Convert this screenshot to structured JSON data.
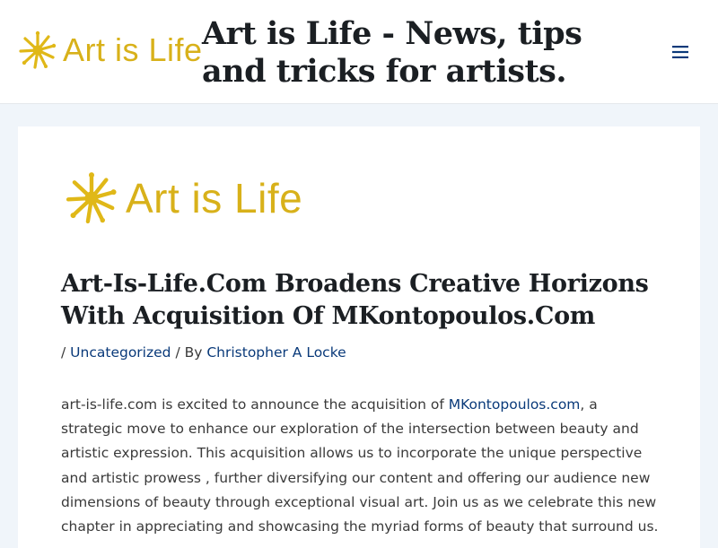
{
  "header": {
    "logo_text": "Art is Life",
    "site_title": "Art is Life - News, tips and tricks for artists.",
    "menu_icon": "hamburger-menu-icon"
  },
  "article": {
    "logo_text": "Art is Life",
    "title": "Art-Is-Life.Com Broadens Creative Horizons With Acquisition Of MKontopoulos.Com",
    "meta": {
      "prefix": "/",
      "category": "Uncategorized",
      "by_label": "/ By",
      "author": "Christopher A Locke"
    },
    "body": {
      "before_link": "art-is-life.com is excited to announce the acquisition of ",
      "link_text": "MKontopoulos.com",
      "after_link": ", a strategic move to enhance our exploration of the intersection between beauty and artistic expression. This acquisition allows us to incorporate the unique perspective and artistic prowess , further diversifying our content and offering our audience new dimensions of beauty through exceptional visual art. Join us as we celebrate this new chapter in appreciating and showcasing the myriad forms of beauty that surround us."
    }
  },
  "colors": {
    "page_background": "#f0f5fa",
    "logo_yellow": "#d8b11a",
    "link_blue": "#0a3a7a",
    "heading": "#1b1f23",
    "text": "#3a3a3a"
  }
}
